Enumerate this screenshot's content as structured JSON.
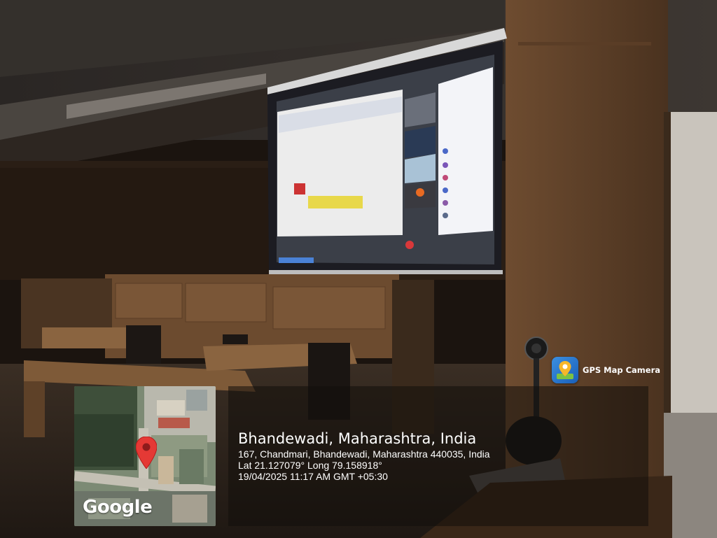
{
  "overlay": {
    "place_title": "Bhandewadi, Maharashtra, India",
    "address": "167, Chandmari, Bhandewadi, Maharashtra 440035, India",
    "coordinates": "Lat 21.127079° Long 79.158918°",
    "datetime": "19/04/2025 11:17 AM GMT +05:30"
  },
  "map": {
    "brand": "Google"
  },
  "badge": {
    "app_name": "GPS Map Camera",
    "icon": "location-pin-icon"
  },
  "colors": {
    "pin_red": "#e53935",
    "badge_blue": "#2f7fd6",
    "room_wood": "#6b4a2c"
  }
}
